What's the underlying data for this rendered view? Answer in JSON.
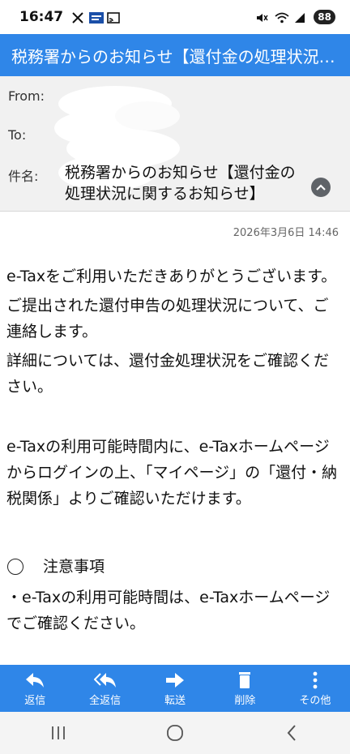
{
  "status_bar": {
    "time": "16:47",
    "battery": "88"
  },
  "titlebar": {
    "title": "税務署からのお知らせ【還付金の処理状況に関するお知らせ】"
  },
  "header": {
    "from_label": "From:",
    "to_label": "To:",
    "subject_label": "件名:",
    "subject": "税務署からのお知らせ【還付金の処理状況に関するお知らせ】"
  },
  "message": {
    "date": "2026年3月6日 14:46",
    "paragraphs": [
      "e-Taxをご利用いただきありがとうございます。",
      "ご提出された還付申告の処理状況について、ご連絡します。",
      "詳細については、還付金処理状況をご確認ください。",
      "e-Taxの利用可能時間内に、e-Taxホームページからログインの上、「マイページ」の「還付・納税関係」よりご確認いただけます。"
    ],
    "notice_heading": "注意事項",
    "notice_item": "・e-Taxの利用可能時間は、e-Taxホームページでご確認ください。"
  },
  "actions": [
    {
      "label": "返信",
      "icon": "reply-icon"
    },
    {
      "label": "全返信",
      "icon": "reply-all-icon"
    },
    {
      "label": "転送",
      "icon": "forward-icon"
    },
    {
      "label": "削除",
      "icon": "trash-icon"
    },
    {
      "label": "その他",
      "icon": "more-vert-icon"
    }
  ],
  "colors": {
    "accent": "#2f86e8",
    "header_bg": "#f1f1f1"
  }
}
